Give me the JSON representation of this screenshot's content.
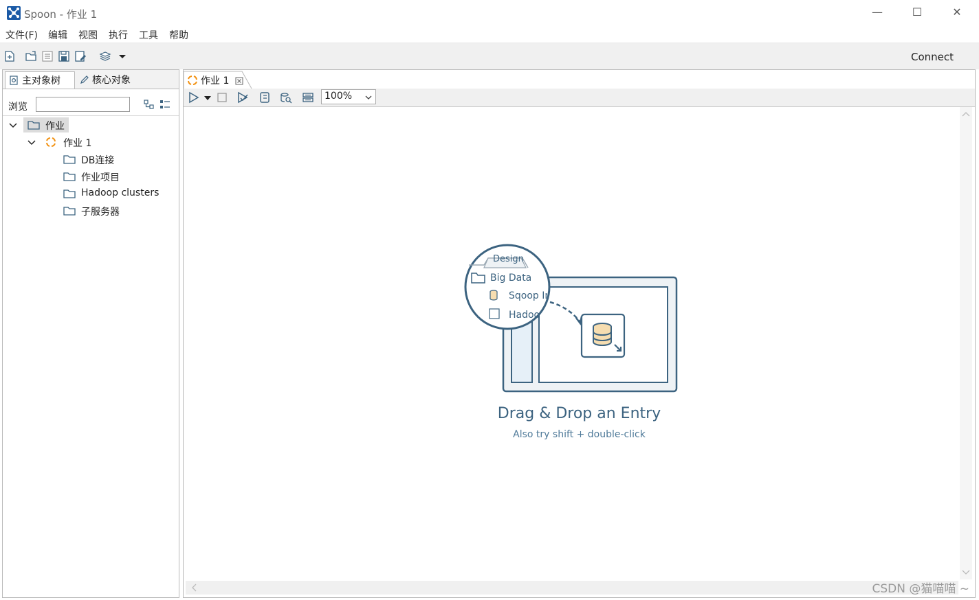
{
  "window": {
    "title": "Spoon - 作业 1",
    "minimize": "—",
    "maximize": "☐",
    "close": "✕"
  },
  "menu": [
    "文件(F)",
    "编辑",
    "视图",
    "执行",
    "工具",
    "帮助"
  ],
  "toolbar": {
    "icons": [
      "new-file-icon",
      "open-folder-icon",
      "explore-icon",
      "save-icon",
      "save-as-icon",
      "layers-icon",
      "dropdown-arrow-icon"
    ],
    "connect_label": "Connect"
  },
  "left_panel": {
    "tabs": [
      {
        "label": "主对象树",
        "icon": "tree-search-icon",
        "active": true
      },
      {
        "label": "核心对象",
        "icon": "pencil-icon",
        "active": false
      }
    ],
    "search_label": "浏览",
    "search_value": "",
    "tree": [
      {
        "label": "作业",
        "level": 0,
        "icon": "folder-icon",
        "expanded": true,
        "selected": true
      },
      {
        "label": "作业 1",
        "level": 1,
        "icon": "job-icon",
        "expanded": true
      },
      {
        "label": "DB连接",
        "level": 2,
        "icon": "folder-icon"
      },
      {
        "label": "作业项目",
        "level": 2,
        "icon": "folder-icon"
      },
      {
        "label": "Hadoop clusters",
        "level": 2,
        "icon": "folder-icon"
      },
      {
        "label": "子服务器",
        "level": 2,
        "icon": "folder-icon"
      }
    ]
  },
  "editor": {
    "tab_label": "作业 1",
    "zoom": "100%",
    "illustration": {
      "tab": "Design",
      "folder": "Big Data",
      "item1": "Sqoop In",
      "item2": "Hadoop"
    },
    "empty_title": "Drag & Drop an Entry",
    "empty_subtitle": "Also try shift + double-click"
  },
  "watermark": "CSDN @猫喵喵 ~",
  "colors": {
    "accent": "#3c6380",
    "job_orange": "#f29111",
    "selection": "#dcdcdc"
  }
}
